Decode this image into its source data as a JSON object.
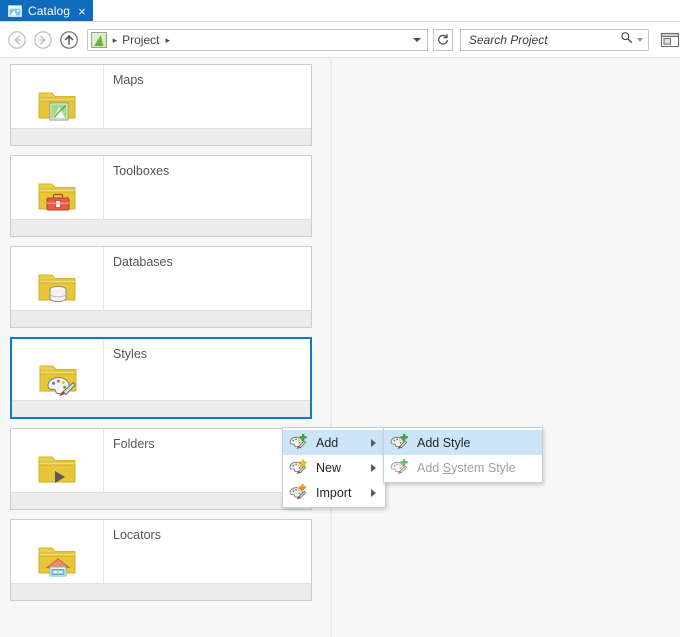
{
  "window": {
    "tab": {
      "label": "Catalog",
      "icon": "catalog-icon",
      "close_label": "×",
      "active_color": "#0f6cbd"
    }
  },
  "toolbar": {
    "back": {
      "name": "back-button",
      "enabled": false
    },
    "forward": {
      "name": "forward-button",
      "enabled": false
    },
    "up": {
      "name": "up-button",
      "enabled": true
    },
    "breadcrumb": {
      "root_icon": "project-icon",
      "separator": "▸",
      "items": [
        {
          "label": "Project"
        }
      ]
    },
    "dropdown_caret": "▾",
    "refresh": {
      "name": "refresh-button",
      "glyph": "↻"
    },
    "search": {
      "placeholder": "Search Project",
      "value": "",
      "icon": "magnifier-icon",
      "caret": "▾"
    },
    "view_panel": {
      "name": "panel-layout-button"
    }
  },
  "catalog": {
    "items": [
      {
        "title": "Maps",
        "icon": "folder-map-icon",
        "selected": false
      },
      {
        "title": "Toolboxes",
        "icon": "folder-toolbox-icon",
        "selected": false
      },
      {
        "title": "Databases",
        "icon": "folder-database-icon",
        "selected": false
      },
      {
        "title": "Styles",
        "icon": "folder-style-icon",
        "selected": true
      },
      {
        "title": "Folders",
        "icon": "folder-play-icon",
        "selected": false
      },
      {
        "title": "Locators",
        "icon": "folder-locator-icon",
        "selected": false
      }
    ]
  },
  "context_menu": {
    "primary": {
      "items": [
        {
          "label": "Add",
          "icon": "style-add-icon",
          "submenu": true,
          "highlighted": true,
          "disabled": false
        },
        {
          "label": "New",
          "icon": "style-new-icon",
          "submenu": true,
          "highlighted": false,
          "disabled": false
        },
        {
          "label": "Import",
          "icon": "style-import-icon",
          "submenu": true,
          "highlighted": false,
          "disabled": false
        }
      ]
    },
    "submenu": {
      "parent": "Add",
      "items": [
        {
          "label": "Add Style",
          "icon": "style-add-icon",
          "highlighted": true,
          "disabled": false,
          "accel_char": ""
        },
        {
          "label": "Add System Style",
          "icon": "style-add-icon",
          "highlighted": false,
          "disabled": true,
          "accel_char": "S"
        }
      ]
    }
  },
  "colors": {
    "accent_blue": "#0f6cbd",
    "selection_border": "#0f7ac7",
    "menu_highlight": "#cce4f7",
    "folder_yellow": "#e8c63a",
    "background": "#f7f7f7"
  }
}
